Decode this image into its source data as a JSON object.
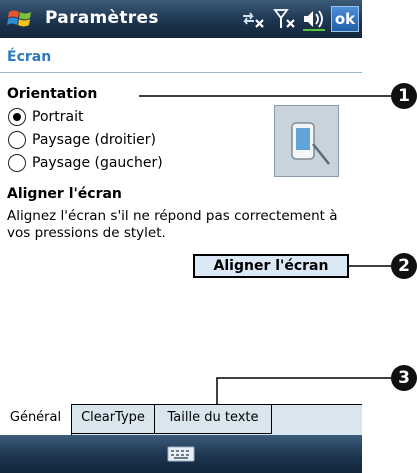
{
  "titlebar": {
    "title": "Paramètres",
    "ok_label": "ok",
    "icons": [
      "windows-start-icon",
      "connectivity-icon",
      "signal-off-icon",
      "volume-icon"
    ]
  },
  "page": {
    "heading": "Écran"
  },
  "orientation": {
    "title": "Orientation",
    "options": [
      {
        "label": "Portrait",
        "selected": true
      },
      {
        "label": "Paysage (droitier)",
        "selected": false
      },
      {
        "label": "Paysage (gaucher)",
        "selected": false
      }
    ],
    "preview_icon": "device-rotation-icon"
  },
  "align": {
    "title": "Aligner l'écran",
    "description": "Alignez l'écran s'il ne répond pas correctement à vos pressions de stylet.",
    "button_label": "Aligner l'écran"
  },
  "tabs": [
    {
      "label": "Général",
      "active": true
    },
    {
      "label": "ClearType",
      "active": false
    },
    {
      "label": "Taille du texte",
      "active": false
    }
  ],
  "menubar": {
    "icon": "keyboard-icon"
  },
  "callouts": [
    "1",
    "2",
    "3"
  ],
  "colors": {
    "bar_dark": "#1d3550",
    "heading_blue": "#2b7bc4",
    "tab_bg": "#d9e6ee",
    "button_bg": "#dbe8f5"
  }
}
